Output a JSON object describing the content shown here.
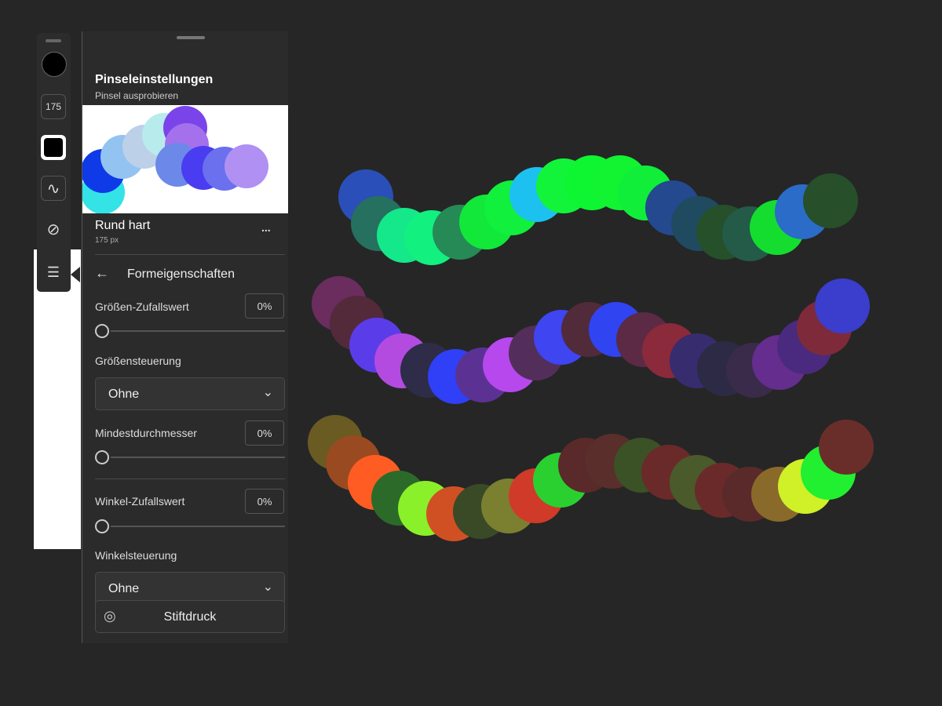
{
  "toolbar": {
    "size_value": "175"
  },
  "panel": {
    "title": "Pinseleinstellungen",
    "subtitle": "Pinsel ausprobieren",
    "brush_name": "Rund hart",
    "brush_size": "175 px",
    "more_label": "...",
    "section_title": "Formeigenschaften",
    "size_jitter": {
      "label": "Größen-Zufallswert",
      "value": "0%",
      "fraction": 0
    },
    "size_control": {
      "label": "Größensteuerung",
      "selected": "Ohne"
    },
    "min_diameter": {
      "label": "Mindestdurchmesser",
      "value": "0%",
      "fraction": 0
    },
    "angle_jitter": {
      "label": "Winkel-Zufallswert",
      "value": "0%",
      "fraction": 0
    },
    "angle_control": {
      "label": "Winkelsteuerung",
      "selected": "Ohne"
    },
    "pen_pressure_label": "Stiftdruck"
  },
  "colors": {
    "background": "#262626",
    "panel": "#2b2b2b"
  }
}
